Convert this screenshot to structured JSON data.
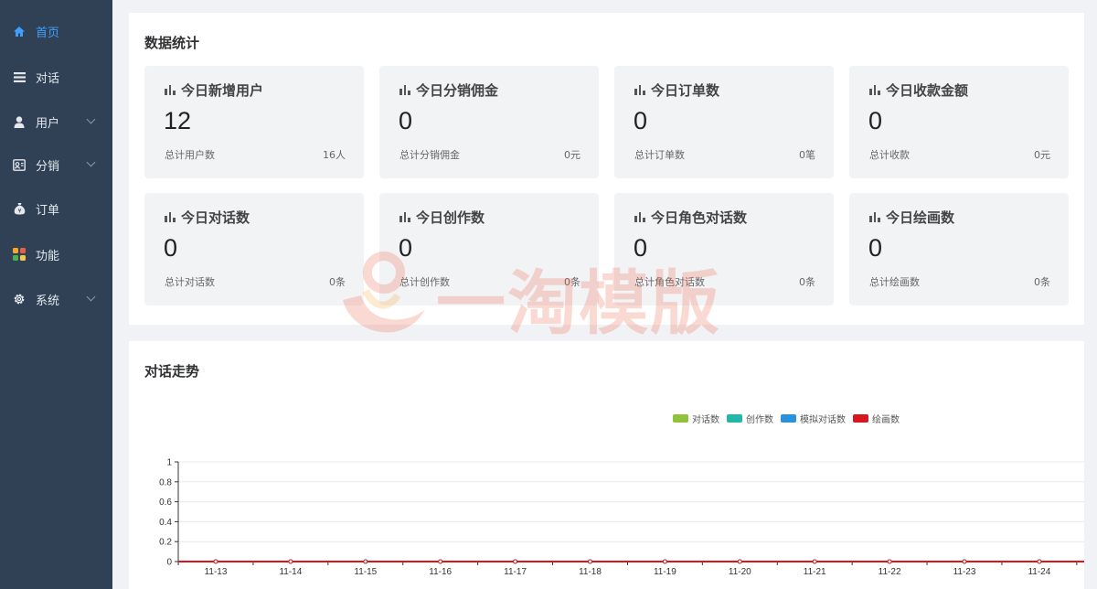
{
  "sidebar": {
    "items": [
      {
        "label": "首页",
        "active": true,
        "has_arrow": false,
        "icon": "home-icon"
      },
      {
        "label": "对话",
        "active": false,
        "has_arrow": false,
        "icon": "list-icon"
      },
      {
        "label": "用户",
        "active": false,
        "has_arrow": true,
        "icon": "user-icon"
      },
      {
        "label": "分销",
        "active": false,
        "has_arrow": true,
        "icon": "distribution-icon"
      },
      {
        "label": "订单",
        "active": false,
        "has_arrow": false,
        "icon": "money-bag-icon"
      },
      {
        "label": "功能",
        "active": false,
        "has_arrow": false,
        "icon": "apps-icon"
      },
      {
        "label": "系统",
        "active": false,
        "has_arrow": true,
        "icon": "gear-icon"
      }
    ]
  },
  "stats": {
    "title": "数据统计",
    "cards": [
      {
        "title": "今日新增用户",
        "value": "12",
        "foot_label": "总计用户数",
        "foot_value": "16人"
      },
      {
        "title": "今日分销佣金",
        "value": "0",
        "foot_label": "总计分销佣金",
        "foot_value": "0元"
      },
      {
        "title": "今日订单数",
        "value": "0",
        "foot_label": "总计订单数",
        "foot_value": "0笔"
      },
      {
        "title": "今日收款金额",
        "value": "0",
        "foot_label": "总计收款",
        "foot_value": "0元"
      },
      {
        "title": "今日对话数",
        "value": "0",
        "foot_label": "总计对话数",
        "foot_value": "0条"
      },
      {
        "title": "今日创作数",
        "value": "0",
        "foot_label": "总计创作数",
        "foot_value": "0条"
      },
      {
        "title": "今日角色对话数",
        "value": "0",
        "foot_label": "总计角色对话数",
        "foot_value": "0条"
      },
      {
        "title": "今日绘画数",
        "value": "0",
        "foot_label": "总计绘画数",
        "foot_value": "0条"
      }
    ]
  },
  "watermark": {
    "text": "一淘模版"
  },
  "trend": {
    "title": "对话走势"
  },
  "chart_data": {
    "type": "line",
    "title": "对话走势",
    "categories": [
      "11-13",
      "11-14",
      "11-15",
      "11-16",
      "11-17",
      "11-18",
      "11-19",
      "11-20",
      "11-21",
      "11-22",
      "11-23",
      "11-24"
    ],
    "series": [
      {
        "name": "对话数",
        "color": "#91c23c",
        "values": [
          0,
          0,
          0,
          0,
          0,
          0,
          0,
          0,
          0,
          0,
          0,
          0
        ]
      },
      {
        "name": "创作数",
        "color": "#22b7a6",
        "values": [
          0,
          0,
          0,
          0,
          0,
          0,
          0,
          0,
          0,
          0,
          0,
          0
        ]
      },
      {
        "name": "模拟对话数",
        "color": "#2a91db",
        "values": [
          0,
          0,
          0,
          0,
          0,
          0,
          0,
          0,
          0,
          0,
          0,
          0
        ]
      },
      {
        "name": "绘画数",
        "color": "#d7161e",
        "values": [
          0,
          0,
          0,
          0,
          0,
          0,
          0,
          0,
          0,
          0,
          0,
          0
        ]
      }
    ],
    "yticks": [
      "0",
      "0.2",
      "0.4",
      "0.6",
      "0.8",
      "1"
    ],
    "ylim": [
      0,
      1
    ],
    "legend_position": "top-right",
    "grid": true
  }
}
